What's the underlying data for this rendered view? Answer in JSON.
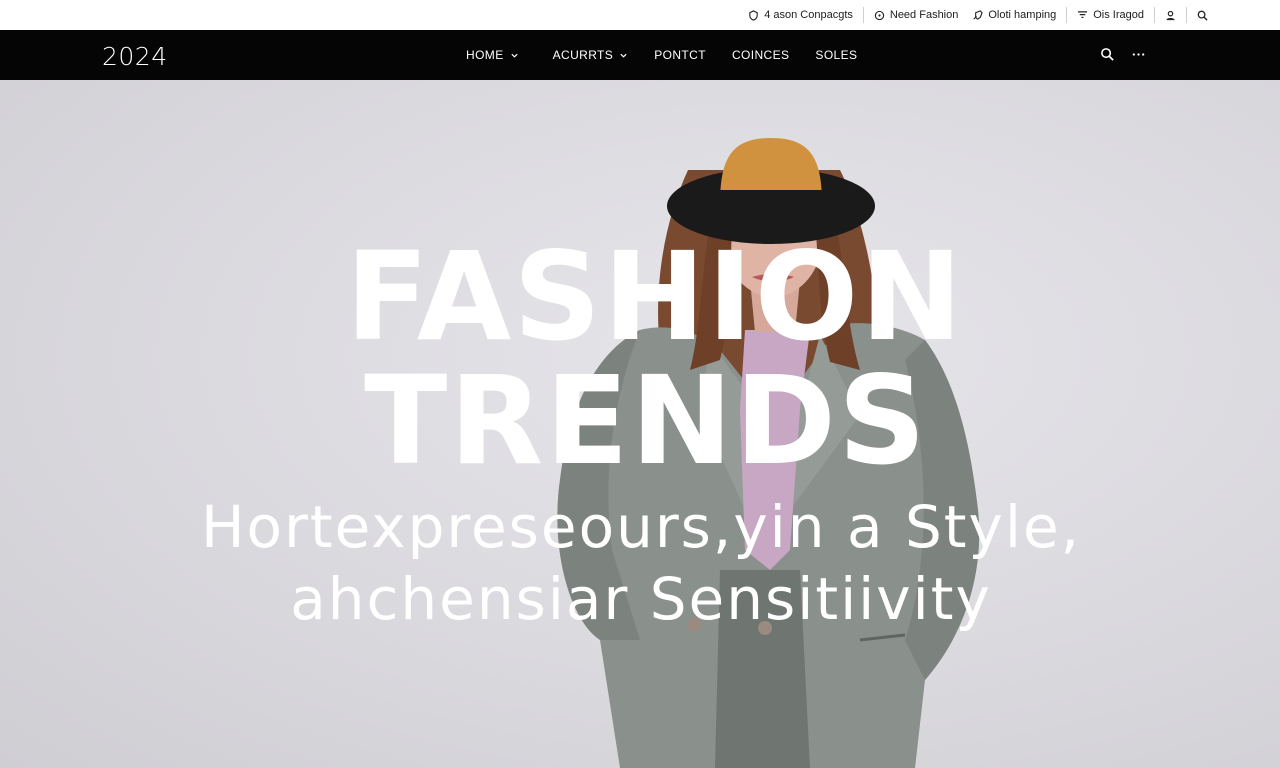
{
  "utility_bar": {
    "items": [
      {
        "label": "4 ason Conpacgts",
        "icon": "user-shield-icon"
      },
      {
        "label": "Need Fashion",
        "icon": "tag-icon"
      },
      {
        "label": "Oloti hamping",
        "icon": "rocket-icon"
      },
      {
        "label": "Ois Iragod",
        "icon": "filter-icon"
      },
      {
        "label": "",
        "icon": "user-icon"
      },
      {
        "label": "",
        "icon": "search-icon"
      }
    ]
  },
  "nav": {
    "brand": "2024",
    "items": [
      {
        "label": "HOME",
        "has_dropdown": true
      },
      {
        "label": "ACURRTS",
        "has_dropdown": true
      },
      {
        "label": "PONTCT",
        "has_dropdown": false
      },
      {
        "label": "COINCES",
        "has_dropdown": false
      },
      {
        "label": "SOLES",
        "has_dropdown": false
      }
    ],
    "tools": [
      "search-icon",
      "more-icon"
    ]
  },
  "hero": {
    "headline_line1": "FASHION",
    "headline_line2": "TRENDS",
    "subline_line1": "Hortexpreseours,yin a Style,",
    "subline_line2": "ahchensiar Sensitiivity"
  },
  "colors": {
    "nav_bg": "#050505",
    "hero_bg": "#dcdbe0",
    "hat": "#d1923f",
    "coat": "#8a908c",
    "shirt": "#c7a7c4"
  }
}
